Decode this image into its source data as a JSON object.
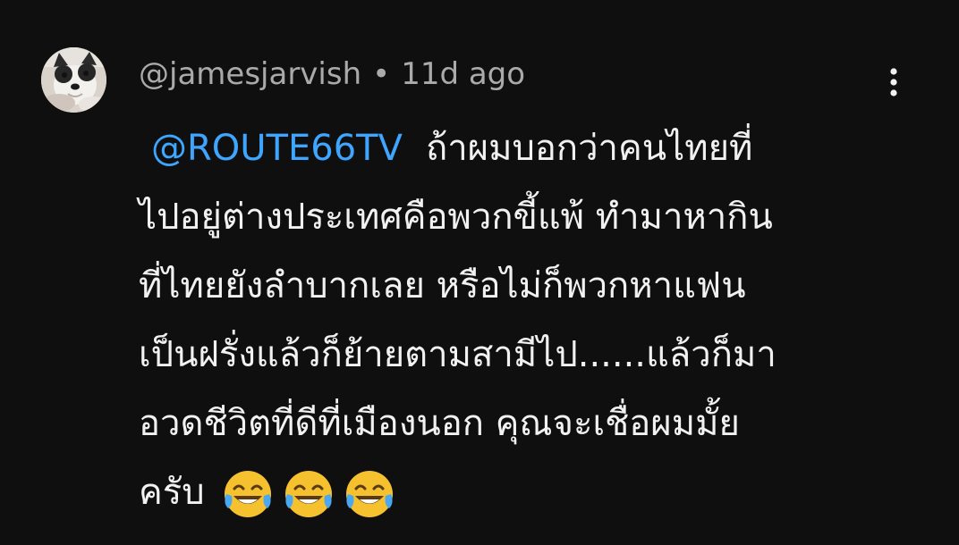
{
  "comment": {
    "author": "@jamesjarvish",
    "separator": "•",
    "time_ago": "11d ago",
    "mention": "@ROUTE66TV",
    "text_lines": [
      "ถ้าผมบอกว่าคนไทยที่",
      "ไปอยู่ต่างประเทศคือพวกขี้แพ้ ทำมาหากิน",
      "ที่ไทยยังลำบากเลย หรือไม่ก็พวกหาแฟน",
      "เป็นฝรั่งแล้วก็ย้ายตามสามีไป......แล้วก็มา",
      "อวดชีวิตที่ดีที่เมืองนอก คุณจะเชื่อผมมั้ย",
      "ครับ"
    ],
    "emojis": [
      "😂",
      "😂",
      "😂"
    ],
    "more_icon": "three-dots-vertical-icon",
    "avatar_icon": "dog-avatar"
  },
  "colors": {
    "background": "#0f0f0f",
    "text": "#f1f1f1",
    "meta": "#aaaaaa",
    "mention": "#3ea6ff"
  }
}
